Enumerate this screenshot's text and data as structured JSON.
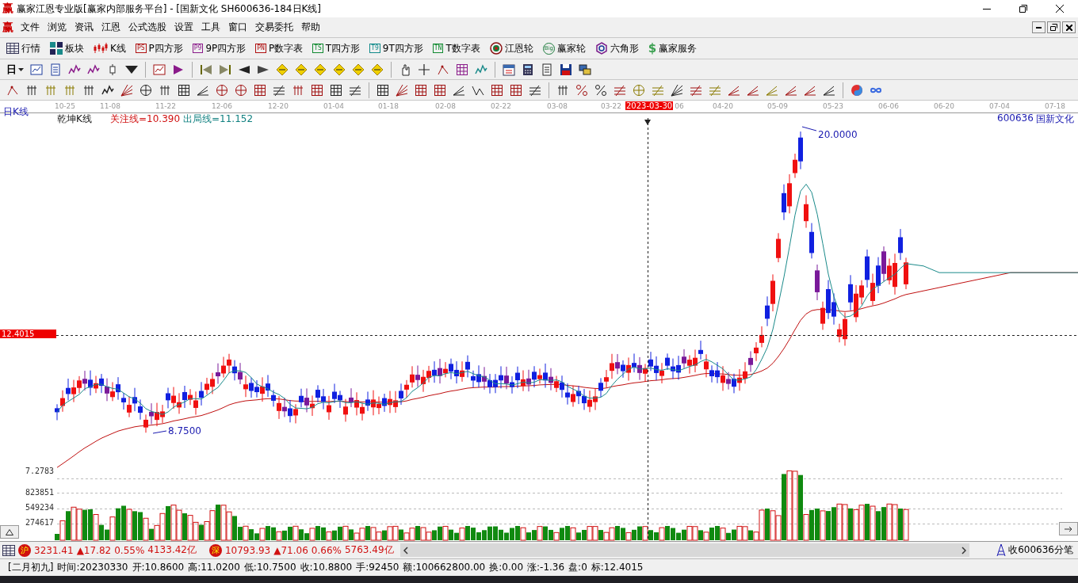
{
  "window": {
    "logo": "赢",
    "title": "赢家江恩专业版[赢家内部服务平台] - [国新文化  SH600636-184日K线]"
  },
  "menu": {
    "logo": "赢",
    "items": [
      "文件",
      "浏览",
      "资讯",
      "江恩",
      "公式选股",
      "设置",
      "工具",
      "窗口",
      "交易委托",
      "帮助"
    ]
  },
  "toolbar": [
    {
      "kind": "grid",
      "label": "行情"
    },
    {
      "kind": "blocks",
      "label": "板块"
    },
    {
      "kind": "candles",
      "label": "K线"
    },
    {
      "kind": "badge",
      "badge": "PS",
      "color": "#b01010",
      "label": "P四方形"
    },
    {
      "kind": "badge",
      "badge": "P9",
      "color": "#8a1a8a",
      "label": "9P四方形"
    },
    {
      "kind": "badge",
      "badge": "PN",
      "color": "#b01010",
      "label": "P数字表"
    },
    {
      "kind": "badge",
      "badge": "TS",
      "color": "#108a30",
      "label": "T四方形"
    },
    {
      "kind": "badge",
      "badge": "T9",
      "color": "#108a8a",
      "label": "9T四方形"
    },
    {
      "kind": "badge",
      "badge": "TN",
      "color": "#108a30",
      "label": "T数字表"
    },
    {
      "kind": "target",
      "label": "江恩轮"
    },
    {
      "kind": "coin",
      "badge": "Big",
      "label": "赢家轮"
    },
    {
      "kind": "hexagon",
      "label": "六角形"
    },
    {
      "kind": "dollar",
      "badge": "$",
      "label": "赢家服务"
    }
  ],
  "period_button": {
    "label": "日"
  },
  "chart": {
    "period": "日K线",
    "indicator": "乾坤K线",
    "watch_line": "关注线=10.390",
    "exit_line": "出局线=11.152",
    "code": "600636",
    "name": "国新文化",
    "dates": [
      {
        "label": "10-25"
      },
      {
        "label": "11-08"
      },
      {
        "label": "11-22"
      },
      {
        "label": "12-06"
      },
      {
        "label": "12-20"
      },
      {
        "label": "01-04"
      },
      {
        "label": "01-18"
      },
      {
        "label": "02-08"
      },
      {
        "label": "02-22"
      },
      {
        "label": "03-08"
      },
      {
        "label": "03-22"
      },
      {
        "label": "06"
      },
      {
        "label": "04-20"
      },
      {
        "label": "05-09"
      },
      {
        "label": "05-23"
      },
      {
        "label": "06-06"
      },
      {
        "label": "06-20"
      },
      {
        "label": "07-04"
      },
      {
        "label": "07-18"
      }
    ],
    "cursor_date": "2023-03-30",
    "cursor_price": "12.4015",
    "high_label": "20.0000",
    "low_label": "8.7500",
    "price_floor": "7.2783",
    "volume_ticks": [
      "823851",
      "549234",
      "274617"
    ]
  },
  "index_bar": [
    {
      "badge": "沪",
      "value": "3231.41",
      "change": "▲17.82",
      "percent": "0.55%",
      "amount": "4133.42亿"
    },
    {
      "badge": "深",
      "value": "10793.93",
      "change": "▲71.06",
      "percent": "0.66%",
      "amount": "5763.49亿"
    }
  ],
  "ticks_link": "收600636分笔",
  "status_bar": [
    "[二月初九]",
    "时间:20230330",
    "开:10.8600",
    "高:11.0200",
    "低:10.7500",
    "收:10.8800",
    "手:92450",
    "额:100662800.00",
    "换:0.00",
    "涨:-1.36",
    "盘:0",
    "标:12.4015"
  ]
}
